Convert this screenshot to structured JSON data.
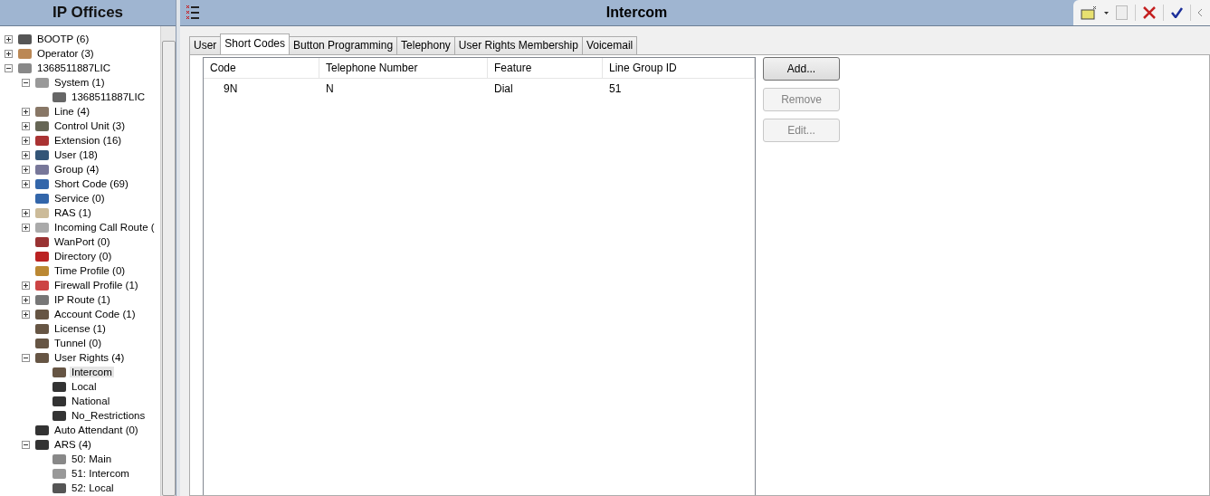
{
  "navigator": {
    "title": "IP Offices",
    "tree": [
      {
        "label": "BOOTP (6)",
        "expanded": false,
        "selected": false
      },
      {
        "label": "Operator (3)",
        "expanded": false,
        "selected": false
      },
      {
        "label": "1368511887LIC",
        "expanded": true,
        "selected": false,
        "children": [
          {
            "label": "System (1)",
            "expanded": true,
            "selected": false,
            "children": [
              {
                "label": "1368511887LIC",
                "selected": false
              }
            ]
          },
          {
            "label": "Line (4)",
            "expanded": false,
            "selected": false
          },
          {
            "label": "Control Unit (3)",
            "expanded": false,
            "selected": false
          },
          {
            "label": "Extension (16)",
            "expanded": false,
            "selected": false
          },
          {
            "label": "User (18)",
            "expanded": false,
            "selected": false
          },
          {
            "label": "Group (4)",
            "expanded": false,
            "selected": false
          },
          {
            "label": "Short Code (69)",
            "expanded": false,
            "selected": false
          },
          {
            "label": "Service (0)",
            "selected": false
          },
          {
            "label": "RAS (1)",
            "expanded": false,
            "selected": false
          },
          {
            "label": "Incoming Call Route (",
            "expanded": false,
            "selected": false
          },
          {
            "label": "WanPort (0)",
            "selected": false
          },
          {
            "label": "Directory (0)",
            "selected": false
          },
          {
            "label": "Time Profile (0)",
            "selected": false
          },
          {
            "label": "Firewall Profile (1)",
            "expanded": false,
            "selected": false
          },
          {
            "label": "IP Route (1)",
            "expanded": false,
            "selected": false
          },
          {
            "label": "Account Code (1)",
            "expanded": false,
            "selected": false
          },
          {
            "label": "License (1)",
            "selected": false
          },
          {
            "label": "Tunnel (0)",
            "selected": false
          },
          {
            "label": "User Rights (4)",
            "expanded": true,
            "selected": false,
            "children": [
              {
                "label": "Intercom",
                "selected": true
              },
              {
                "label": "Local",
                "selected": false
              },
              {
                "label": "National",
                "selected": false
              },
              {
                "label": "No_Restrictions",
                "selected": false
              }
            ]
          },
          {
            "label": "Auto Attendant (0)",
            "selected": false
          },
          {
            "label": "ARS (4)",
            "expanded": true,
            "selected": false,
            "children": [
              {
                "label": "50: Main",
                "selected": false
              },
              {
                "label": "51: Intercom",
                "selected": false
              },
              {
                "label": "52: Local",
                "selected": false
              }
            ]
          }
        ]
      }
    ]
  },
  "editor": {
    "title": "Intercom",
    "tabs": [
      {
        "label": "User",
        "selected": false
      },
      {
        "label": "Short Codes",
        "selected": true
      },
      {
        "label": "Button Programming",
        "selected": false
      },
      {
        "label": "Telephony",
        "selected": false
      },
      {
        "label": "User Rights Membership",
        "selected": false
      },
      {
        "label": "Voicemail",
        "selected": false
      }
    ],
    "table": {
      "columns": [
        "Code",
        "Telephone Number",
        "Feature",
        "Line Group ID"
      ],
      "rows": [
        [
          "9N",
          "N",
          "Dial",
          "51"
        ]
      ]
    },
    "buttons": [
      {
        "label": "Add...",
        "disabled": false
      },
      {
        "label": "Remove",
        "disabled": true
      },
      {
        "label": "Edit...",
        "disabled": true
      }
    ]
  }
}
